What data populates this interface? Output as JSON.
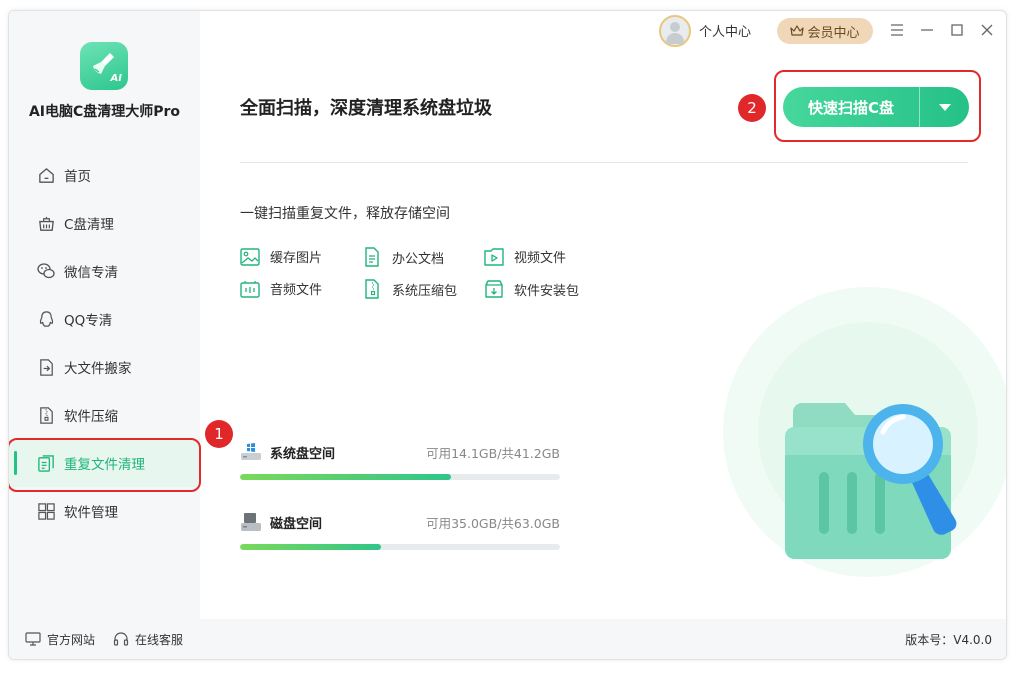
{
  "app": {
    "title": "AI电脑C盘清理大师Pro",
    "logo_badge": "AI"
  },
  "topbar": {
    "user_center": "个人中心",
    "vip_center": "会员中心"
  },
  "sidebar": {
    "items": [
      {
        "label": "首页",
        "icon": "home-icon"
      },
      {
        "label": "C盘清理",
        "icon": "broom-icon"
      },
      {
        "label": "微信专清",
        "icon": "wechat-icon"
      },
      {
        "label": "QQ专清",
        "icon": "qq-icon"
      },
      {
        "label": "大文件搬家",
        "icon": "move-file-icon"
      },
      {
        "label": "软件压缩",
        "icon": "compress-icon"
      },
      {
        "label": "重复文件清理",
        "icon": "duplicate-file-icon",
        "active": true
      },
      {
        "label": "软件管理",
        "icon": "apps-icon"
      }
    ]
  },
  "main": {
    "title": "全面扫描，深度清理系统盘垃圾",
    "scan_button": "快速扫描C盘",
    "subtitle": "一键扫描重复文件，释放存储空间",
    "categories": [
      {
        "label": "缓存图片",
        "icon": "image-icon"
      },
      {
        "label": "办公文档",
        "icon": "document-icon"
      },
      {
        "label": "视频文件",
        "icon": "video-icon"
      },
      {
        "label": "音频文件",
        "icon": "audio-icon"
      },
      {
        "label": "系统压缩包",
        "icon": "zip-icon"
      },
      {
        "label": "软件安装包",
        "icon": "install-icon"
      }
    ],
    "disks": [
      {
        "name": "系统盘空间",
        "capacity": "可用14.1GB/共41.2GB",
        "used_fraction": 0.66,
        "icon": "windows-drive-icon"
      },
      {
        "name": "磁盘空间",
        "capacity": "可用35.0GB/共63.0GB",
        "used_fraction": 0.44,
        "icon": "disk-drive-icon"
      }
    ]
  },
  "annotations": {
    "badge_1": "1",
    "badge_2": "2"
  },
  "footer": {
    "website": "官方网站",
    "support": "在线客服",
    "version": "版本号：V4.0.0"
  },
  "colors": {
    "accent": "#26c186",
    "highlight": "#e22a2a",
    "vip": "#efd7b8"
  }
}
